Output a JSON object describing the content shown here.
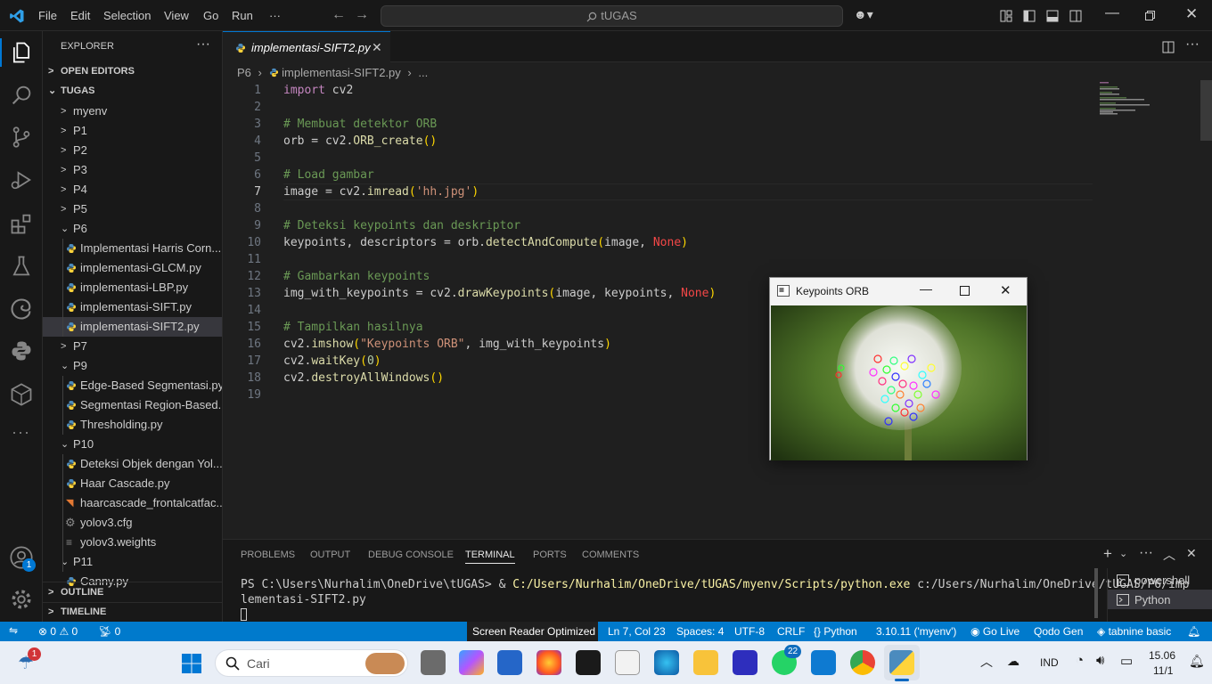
{
  "titlebar": {
    "menus": [
      "File",
      "Edit",
      "Selection",
      "View",
      "Go",
      "Run",
      "···"
    ],
    "search": "tUGAS"
  },
  "sidebar": {
    "title": "EXPLORER",
    "open_editors": "OPEN EDITORS",
    "root": "TUGAS",
    "items": [
      {
        "label": "myenv",
        "type": "folder",
        "open": false,
        "indent": 1
      },
      {
        "label": "P1",
        "type": "folder",
        "open": false,
        "indent": 1
      },
      {
        "label": "P2",
        "type": "folder",
        "open": false,
        "indent": 1
      },
      {
        "label": "P3",
        "type": "folder",
        "open": false,
        "indent": 1
      },
      {
        "label": "P4",
        "type": "folder",
        "open": false,
        "indent": 1
      },
      {
        "label": "P5",
        "type": "folder",
        "open": false,
        "indent": 1
      },
      {
        "label": "P6",
        "type": "folder",
        "open": true,
        "indent": 1
      },
      {
        "label": "Implementasi Harris Corn...",
        "type": "py",
        "indent": 2
      },
      {
        "label": "implementasi-GLCM.py",
        "type": "py",
        "indent": 2
      },
      {
        "label": "implementasi-LBP.py",
        "type": "py",
        "indent": 2
      },
      {
        "label": "implementasi-SIFT.py",
        "type": "py",
        "indent": 2
      },
      {
        "label": "implementasi-SIFT2.py",
        "type": "py",
        "indent": 2,
        "selected": true
      },
      {
        "label": "P7",
        "type": "folder",
        "open": false,
        "indent": 1
      },
      {
        "label": "P9",
        "type": "folder",
        "open": true,
        "indent": 1
      },
      {
        "label": "Edge-Based Segmentasi.py",
        "type": "py",
        "indent": 2
      },
      {
        "label": "Segmentasi Region-Based...",
        "type": "py",
        "indent": 2
      },
      {
        "label": "Thresholding.py",
        "type": "py",
        "indent": 2
      },
      {
        "label": "P10",
        "type": "folder",
        "open": true,
        "indent": 1
      },
      {
        "label": "Deteksi Objek dengan Yol...",
        "type": "py",
        "indent": 2
      },
      {
        "label": "Haar Cascade.py",
        "type": "py",
        "indent": 2
      },
      {
        "label": "haarcascade_frontalcatfac...",
        "type": "rss",
        "indent": 2
      },
      {
        "label": "yolov3.cfg",
        "type": "gear",
        "indent": 2
      },
      {
        "label": "yolov3.weights",
        "type": "lines",
        "indent": 2
      },
      {
        "label": "P11",
        "type": "folder",
        "open": true,
        "indent": 1
      },
      {
        "label": "Canny.py",
        "type": "py",
        "indent": 2
      }
    ],
    "outline": "OUTLINE",
    "timeline": "TIMELINE",
    "account_badge": "1"
  },
  "editor": {
    "tab_label": "implementasi-SIFT2.py",
    "breadcrumb_folder": "P6",
    "breadcrumb_file": "implementasi-SIFT2.py",
    "breadcrumb_more": "...",
    "current_line": 7
  },
  "panel": {
    "tabs": [
      "PROBLEMS",
      "OUTPUT",
      "DEBUG CONSOLE",
      "TERMINAL",
      "PORTS",
      "COMMENTS"
    ],
    "active_tab": "TERMINAL",
    "terminal_prompt": "PS C:\\Users\\Nurhalim\\OneDrive\\tUGAS> & ",
    "terminal_exe": "C:/Users/Nurhalim/OneDrive/tUGAS/myenv/Scripts/python.exe",
    "terminal_arg": " c:/Users/Nurhalim/OneDrive/tUGAS/P6/imp",
    "terminal_line2": "lementasi-SIFT2.py",
    "terminals": [
      "powershell",
      "Python"
    ]
  },
  "statusbar": {
    "errors": "0",
    "warnings": "0",
    "ports": "0",
    "screen_reader": "Screen Reader Optimized",
    "position": "Ln 7, Col 23",
    "spaces": "Spaces: 4",
    "encoding": "UTF-8",
    "eol": "CRLF",
    "language": "Python",
    "interpreter": "3.10.11 ('myenv')",
    "golive": "Go Live",
    "qodo": "Qodo Gen",
    "tabnine": "tabnine basic"
  },
  "popup": {
    "title": "Keypoints ORB"
  },
  "taskbar": {
    "search_placeholder": "Cari",
    "weather_badge": "1",
    "whatsapp_badge": "22",
    "language": "IND",
    "time": "15.06",
    "date": "11/1"
  },
  "colors": {
    "accent": "#007acc",
    "tab_border": "#0078d4",
    "keyword": "#c586c0",
    "comment": "#6a9955",
    "function": "#dcdcaa",
    "string": "#ce9178"
  }
}
